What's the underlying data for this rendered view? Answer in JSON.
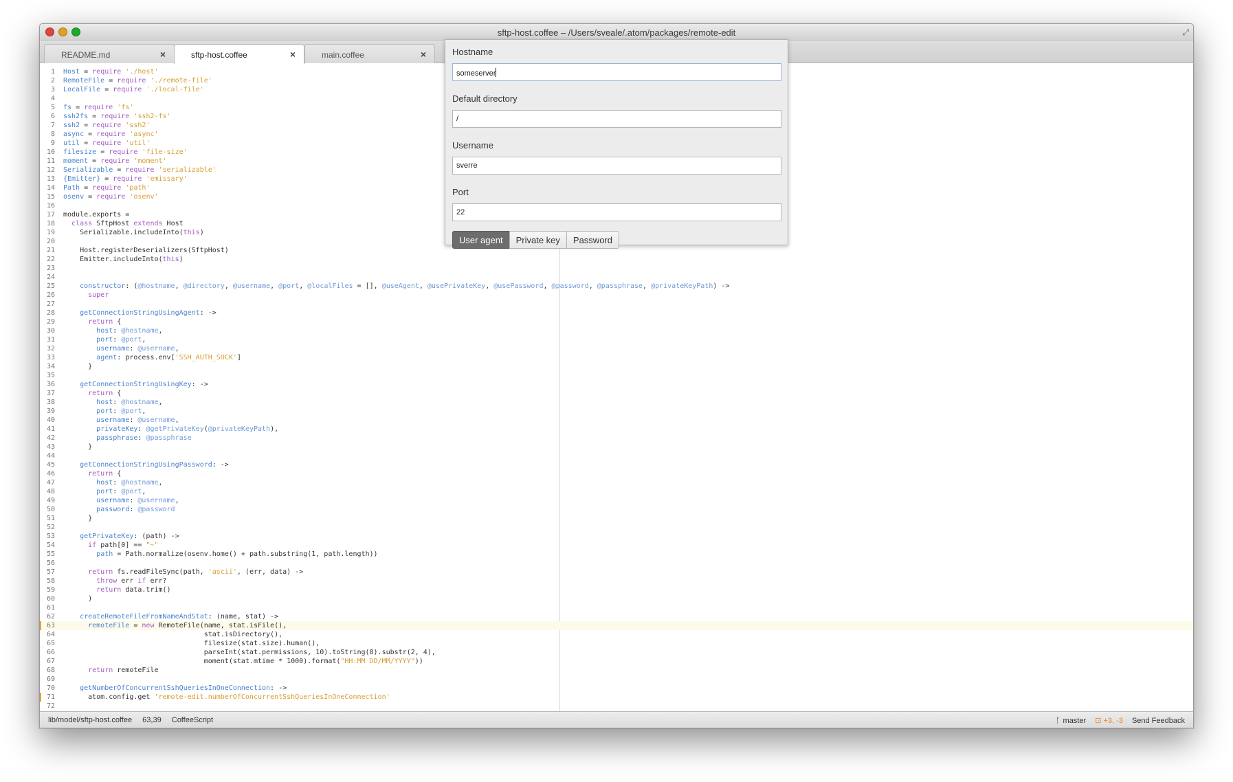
{
  "window": {
    "title": "sftp-host.coffee – /Users/sveale/.atom/packages/remote-edit",
    "traffic_colors": {
      "close": "#e0443e",
      "minimize": "#dea123",
      "maximize": "#1aab29"
    }
  },
  "tabs": [
    {
      "label": "README.md",
      "close": "×"
    },
    {
      "label": "sftp-host.coffee",
      "close": "×"
    },
    {
      "label": "main.coffee",
      "close": "×"
    }
  ],
  "dialog": {
    "hostname": {
      "label": "Hostname",
      "value": "someserver"
    },
    "directory": {
      "label": "Default directory",
      "value": "/"
    },
    "username": {
      "label": "Username",
      "value": "sverre"
    },
    "port": {
      "label": "Port",
      "value": "22"
    },
    "auth_buttons": [
      "User agent",
      "Private key",
      "Password"
    ],
    "selected_auth": "User agent"
  },
  "status": {
    "file_path": "lib/model/sftp-host.coffee",
    "cursor": "63,39",
    "grammar": "CoffeeScript",
    "branch": "master",
    "diff": "+3, -3",
    "feedback": "Send Feedback"
  },
  "code_lines": [
    "Host = require './host'",
    "RemoteFile = require './remote-file'",
    "LocalFile = require './local-file'",
    "",
    "fs = require 'fs'",
    "ssh2fs = require 'ssh2-fs'",
    "ssh2 = require 'ssh2'",
    "async = require 'async'",
    "util = require 'util'",
    "filesize = require 'file-size'",
    "moment = require 'moment'",
    "Serializable = require 'serializable'",
    "{Emitter} = require 'emissary'",
    "Path = require 'path'",
    "osenv = require 'osenv'",
    "",
    "module.exports =",
    "  class SftpHost extends Host",
    "    Serializable.includeInto(this)",
    "",
    "    Host.registerDeserializers(SftpHost)",
    "    Emitter.includeInto(this)",
    "",
    "",
    "    constructor: (@hostname, @directory, @username, @port, @localFiles = [], @useAgent, @usePrivateKey, @usePassword, @password, @passphrase, @privateKeyPath) ->",
    "      super",
    "",
    "    getConnectionStringUsingAgent: ->",
    "      return {",
    "        host: @hostname,",
    "        port: @port,",
    "        username: @username,",
    "        agent: process.env['SSH_AUTH_SOCK']",
    "      }",
    "",
    "    getConnectionStringUsingKey: ->",
    "      return {",
    "        host: @hostname,",
    "        port: @port,",
    "        username: @username,",
    "        privateKey: @getPrivateKey(@privateKeyPath),",
    "        passphrase: @passphrase",
    "      }",
    "",
    "    getConnectionStringUsingPassword: ->",
    "      return {",
    "        host: @hostname,",
    "        port: @port,",
    "        username: @username,",
    "        password: @password",
    "      }",
    "",
    "    getPrivateKey: (path) ->",
    "      if path[0] == \"~\"",
    "        path = Path.normalize(osenv.home() + path.substring(1, path.length))",
    "",
    "      return fs.readFileSync(path, 'ascii', (err, data) ->",
    "        throw err if err?",
    "        return data.trim()",
    "      )",
    "",
    "    createRemoteFileFromNameAndStat: (name, stat) ->",
    "      remoteFile = new RemoteFile(name, stat.isFile(),",
    "                                  stat.isDirectory(),",
    "                                  filesize(stat.size).human(),",
    "                                  parseInt(stat.permissions, 10).toString(8).substr(2, 4),",
    "                                  moment(stat.mtime * 1000).format(\"HH:MM DD/MM/YYYY\"))",
    "      return remoteFile",
    "",
    "    getNumberOfConcurrentSshQueriesInOneConnection: ->",
    "      atom.config.get 'remote-edit.numberOfConcurrentSshQueriesInOneConnection'",
    ""
  ],
  "modified_lines": [
    63,
    71
  ],
  "current_line": 63
}
